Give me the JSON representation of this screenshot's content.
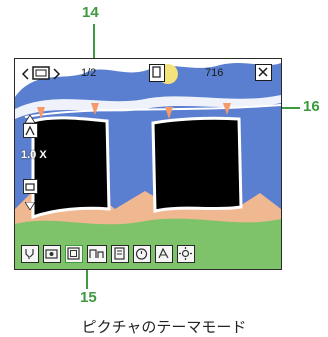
{
  "callouts": {
    "top": "14",
    "right": "16",
    "bottom": "15"
  },
  "status_bar": {
    "page_counter": "1/2",
    "remaining_shots": "716"
  },
  "viewfinder": {
    "zoom_level": "1.0 X"
  },
  "caption": "ピクチャのテーマモード",
  "icons": {
    "nav_prev": "chevron-left-icon",
    "frame_select": "frame-icon",
    "nav_next": "chevron-right-icon",
    "shot_mode": "single-shot-icon",
    "close": "close-icon",
    "zoom": "zoom-icon",
    "brightness_adjust": "exposure-icon"
  },
  "colors": {
    "callout": "#3d9a3d",
    "sky": "#5b7fd0",
    "frame": "#000000"
  }
}
